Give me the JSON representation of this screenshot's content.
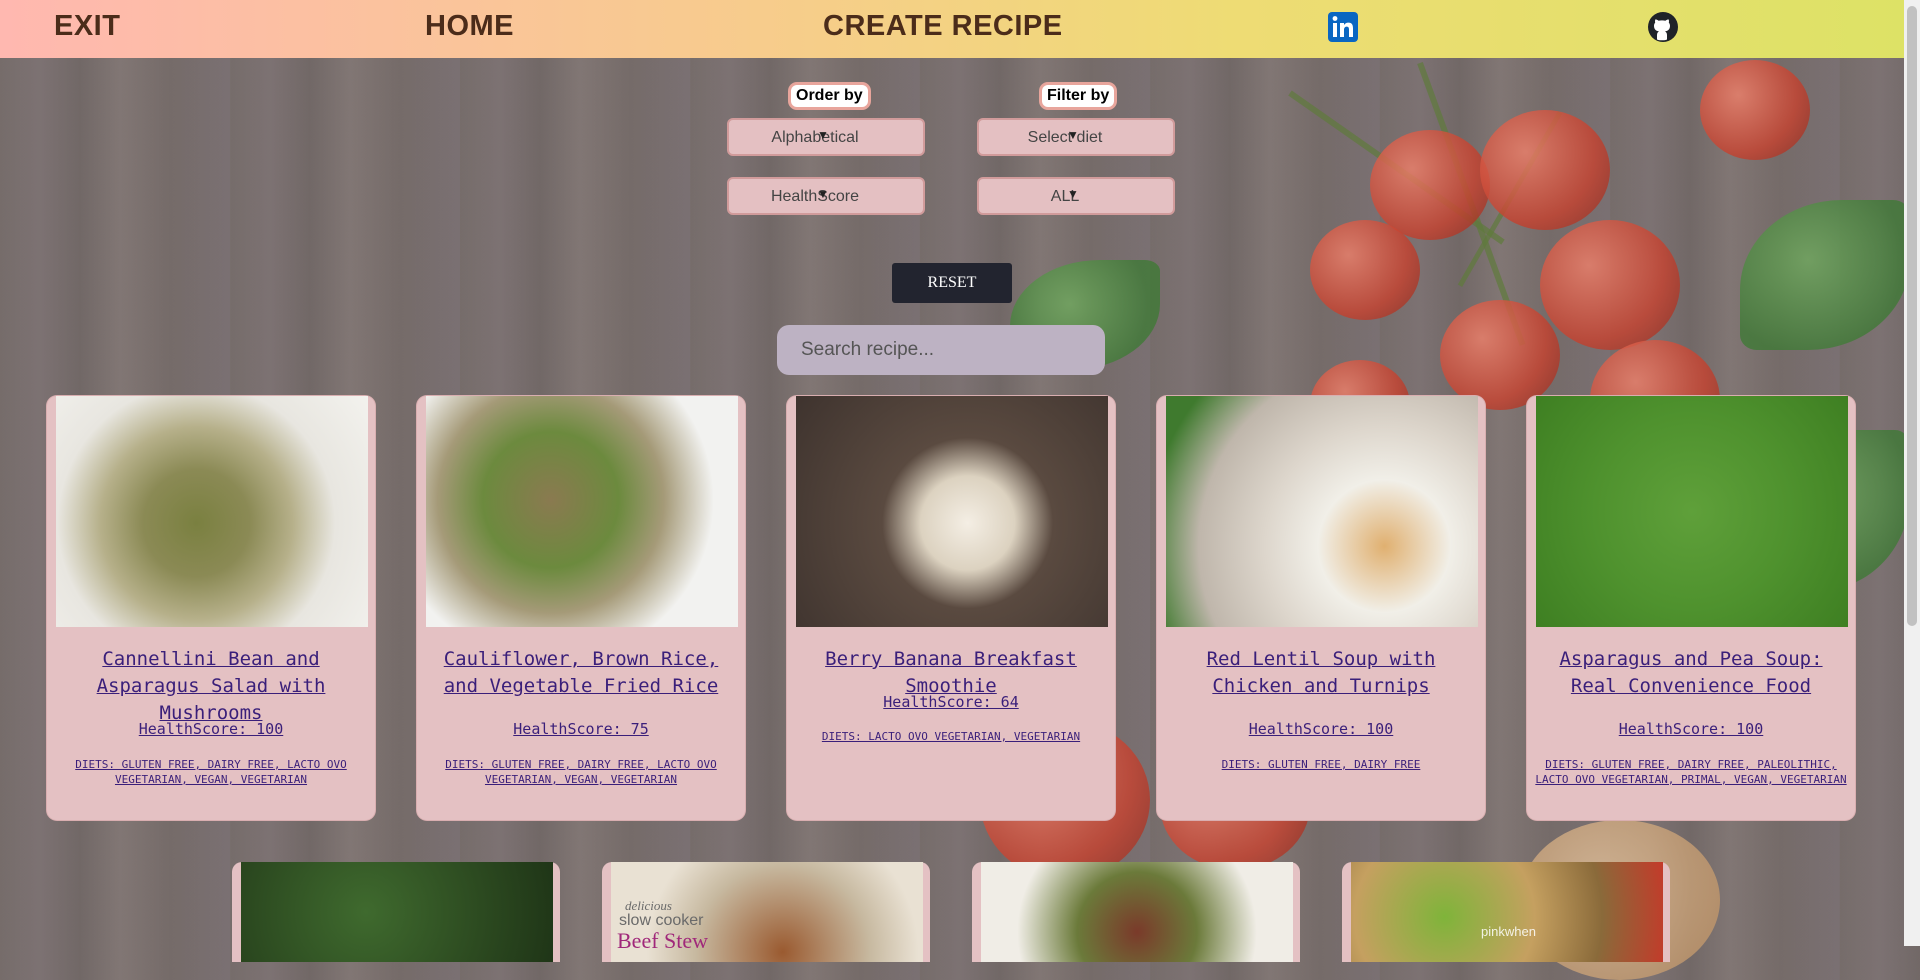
{
  "nav": {
    "exit": "EXIT",
    "home": "HOME",
    "create": "CREATE RECIPE",
    "linkedin_icon": "linkedin-icon",
    "github_icon": "github-icon"
  },
  "controls": {
    "order_label": "Order by",
    "filter_label": "Filter by",
    "order_alpha": "Alphabetical",
    "order_health": "HealthScore",
    "diet_select": "Select diet",
    "filter_all": "ALL",
    "reset": "RESET",
    "search_placeholder": "Search recipe..."
  },
  "recipes": [
    {
      "title": "Cannellini Bean and Asparagus Salad with Mushrooms",
      "health": "HealthScore: 100",
      "diets": "DIETS: GLUTEN FREE, DAIRY FREE, LACTO OVO VEGETARIAN, VEGAN, VEGETARIAN"
    },
    {
      "title": "Cauliflower, Brown Rice, and Vegetable Fried Rice",
      "health": "HealthScore: 75",
      "diets": "DIETS: GLUTEN FREE, DAIRY FREE, LACTO OVO VEGETARIAN, VEGAN, VEGETARIAN"
    },
    {
      "title": "Berry Banana Breakfast Smoothie",
      "health": "HealthScore: 64",
      "diets": "DIETS: LACTO OVO VEGETARIAN, VEGETARIAN"
    },
    {
      "title": "Red Lentil Soup with Chicken and Turnips",
      "health": "HealthScore: 100",
      "diets": "DIETS: GLUTEN FREE, DAIRY FREE"
    },
    {
      "title": "Asparagus and Pea Soup: Real Convenience Food",
      "health": "HealthScore: 100",
      "diets": "DIETS: GLUTEN FREE, DAIRY FREE, PALEOLITHIC, LACTO OVO VEGETARIAN, PRIMAL, VEGAN, VEGETARIAN"
    }
  ],
  "second_row": {
    "beef_stew_caption_1": "delicious",
    "beef_stew_caption_2": "slow cooker",
    "beef_stew_caption_3": "Beef Stew",
    "pinkwhen": "pinkwhen"
  }
}
